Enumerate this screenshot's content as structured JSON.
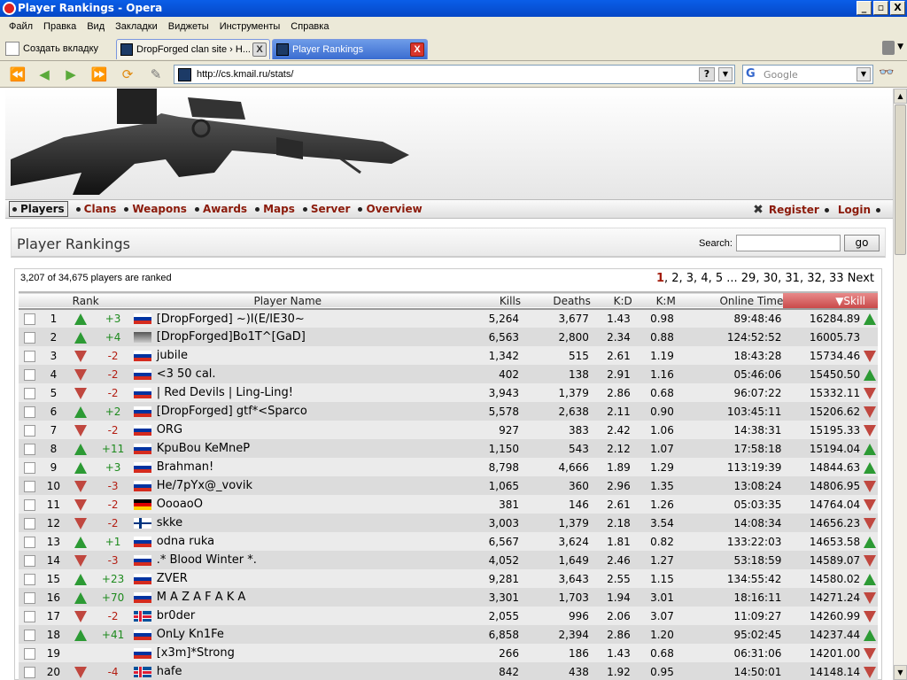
{
  "window": {
    "title": "Player Rankings - Opera",
    "minimize": "_",
    "maximize": "▫",
    "close": "X"
  },
  "menu": [
    "Файл",
    "Правка",
    "Вид",
    "Закладки",
    "Виджеты",
    "Инструменты",
    "Справка"
  ],
  "tabs": {
    "new_tab": "Создать вкладку",
    "tab1": "DropForged clan site › H...",
    "tab2": "Player Rankings",
    "close": "X"
  },
  "address": {
    "url": "http://cs.kmail.ru/stats/",
    "help": "?"
  },
  "searchbox": {
    "engine": "Google"
  },
  "nav": {
    "items": [
      "Players",
      "Clans",
      "Weapons",
      "Awards",
      "Maps",
      "Server",
      "Overview"
    ],
    "register": "Register",
    "login": "Login"
  },
  "panel": {
    "title": "Player Rankings",
    "search_label": "Search:",
    "go": "go"
  },
  "summary": "3,207 of 34,675 players are ranked",
  "pager": {
    "current": "1",
    "rest": ", 2, 3, 4, 5 ... 29, 30, 31, 32, 33",
    "next": "Next"
  },
  "columns": {
    "rank": "Rank",
    "name": "Player Name",
    "kills": "Kills",
    "deaths": "Deaths",
    "kd": "K:D",
    "km": "K:M",
    "time": "Online Time",
    "skill": "Skill"
  },
  "rows": [
    {
      "rank": "1",
      "dir": "up",
      "chg": "+3",
      "flag": "ru",
      "name": "[DropForged] ~)I(E/IE30~",
      "kills": "5,264",
      "deaths": "3,677",
      "kd": "1.43",
      "km": "0.98",
      "time": "89:48:46",
      "skill": "16284.89",
      "sdir": "up"
    },
    {
      "rank": "2",
      "dir": "up",
      "chg": "+4",
      "flag": "gr",
      "name": "[DropForged]Bo1T^[GaD]",
      "kills": "6,563",
      "deaths": "2,800",
      "kd": "2.34",
      "km": "0.88",
      "time": "124:52:52",
      "skill": "16005.73",
      "sdir": ""
    },
    {
      "rank": "3",
      "dir": "down",
      "chg": "-2",
      "flag": "ru",
      "name": "jubile",
      "kills": "1,342",
      "deaths": "515",
      "kd": "2.61",
      "km": "1.19",
      "time": "18:43:28",
      "skill": "15734.46",
      "sdir": "down"
    },
    {
      "rank": "4",
      "dir": "down",
      "chg": "-2",
      "flag": "ru",
      "name": "<3 50 cal.",
      "kills": "402",
      "deaths": "138",
      "kd": "2.91",
      "km": "1.16",
      "time": "05:46:06",
      "skill": "15450.50",
      "sdir": "up"
    },
    {
      "rank": "5",
      "dir": "down",
      "chg": "-2",
      "flag": "ru",
      "name": "| Red Devils | Ling-Ling!",
      "kills": "3,943",
      "deaths": "1,379",
      "kd": "2.86",
      "km": "0.68",
      "time": "96:07:22",
      "skill": "15332.11",
      "sdir": "down"
    },
    {
      "rank": "6",
      "dir": "up",
      "chg": "+2",
      "flag": "ru",
      "name": "[DropForged] gtf*<Sparco",
      "kills": "5,578",
      "deaths": "2,638",
      "kd": "2.11",
      "km": "0.90",
      "time": "103:45:11",
      "skill": "15206.62",
      "sdir": "down"
    },
    {
      "rank": "7",
      "dir": "down",
      "chg": "-2",
      "flag": "ru",
      "name": "ORG",
      "kills": "927",
      "deaths": "383",
      "kd": "2.42",
      "km": "1.06",
      "time": "14:38:31",
      "skill": "15195.33",
      "sdir": "down"
    },
    {
      "rank": "8",
      "dir": "up",
      "chg": "+11",
      "flag": "ru",
      "name": "KpuBou KeMneP",
      "kills": "1,150",
      "deaths": "543",
      "kd": "2.12",
      "km": "1.07",
      "time": "17:58:18",
      "skill": "15194.04",
      "sdir": "up"
    },
    {
      "rank": "9",
      "dir": "up",
      "chg": "+3",
      "flag": "ru",
      "name": "Brahman!",
      "kills": "8,798",
      "deaths": "4,666",
      "kd": "1.89",
      "km": "1.29",
      "time": "113:19:39",
      "skill": "14844.63",
      "sdir": "up"
    },
    {
      "rank": "10",
      "dir": "down",
      "chg": "-3",
      "flag": "ru",
      "name": "He/7pYx@_vovik",
      "kills": "1,065",
      "deaths": "360",
      "kd": "2.96",
      "km": "1.35",
      "time": "13:08:24",
      "skill": "14806.95",
      "sdir": "down"
    },
    {
      "rank": "11",
      "dir": "down",
      "chg": "-2",
      "flag": "de",
      "name": "OooaoO",
      "kills": "381",
      "deaths": "146",
      "kd": "2.61",
      "km": "1.26",
      "time": "05:03:35",
      "skill": "14764.04",
      "sdir": "down"
    },
    {
      "rank": "12",
      "dir": "down",
      "chg": "-2",
      "flag": "fi",
      "name": "skke",
      "kills": "3,003",
      "deaths": "1,379",
      "kd": "2.18",
      "km": "3.54",
      "time": "14:08:34",
      "skill": "14656.23",
      "sdir": "down"
    },
    {
      "rank": "13",
      "dir": "up",
      "chg": "+1",
      "flag": "ru",
      "name": "odna ruka",
      "kills": "6,567",
      "deaths": "3,624",
      "kd": "1.81",
      "km": "0.82",
      "time": "133:22:03",
      "skill": "14653.58",
      "sdir": "up"
    },
    {
      "rank": "14",
      "dir": "down",
      "chg": "-3",
      "flag": "ru",
      "name": ".* Blood Winter *.",
      "kills": "4,052",
      "deaths": "1,649",
      "kd": "2.46",
      "km": "1.27",
      "time": "53:18:59",
      "skill": "14589.07",
      "sdir": "down"
    },
    {
      "rank": "15",
      "dir": "up",
      "chg": "+23",
      "flag": "ru",
      "name": "ZVER",
      "kills": "9,281",
      "deaths": "3,643",
      "kd": "2.55",
      "km": "1.15",
      "time": "134:55:42",
      "skill": "14580.02",
      "sdir": "up"
    },
    {
      "rank": "16",
      "dir": "up",
      "chg": "+70",
      "flag": "ru",
      "name": "M A Z A F A K A",
      "kills": "3,301",
      "deaths": "1,703",
      "kd": "1.94",
      "km": "3.01",
      "time": "18:16:11",
      "skill": "14271.24",
      "sdir": "down"
    },
    {
      "rank": "17",
      "dir": "down",
      "chg": "-2",
      "flag": "is",
      "name": "br0der",
      "kills": "2,055",
      "deaths": "996",
      "kd": "2.06",
      "km": "3.07",
      "time": "11:09:27",
      "skill": "14260.99",
      "sdir": "down"
    },
    {
      "rank": "18",
      "dir": "up",
      "chg": "+41",
      "flag": "ru",
      "name": "OnLy Kn1Fe",
      "kills": "6,858",
      "deaths": "2,394",
      "kd": "2.86",
      "km": "1.20",
      "time": "95:02:45",
      "skill": "14237.44",
      "sdir": "up"
    },
    {
      "rank": "19",
      "dir": "",
      "chg": "",
      "flag": "ru",
      "name": "[x3m]*Strong",
      "kills": "266",
      "deaths": "186",
      "kd": "1.43",
      "km": "0.68",
      "time": "06:31:06",
      "skill": "14201.00",
      "sdir": "down"
    },
    {
      "rank": "20",
      "dir": "down",
      "chg": "-4",
      "flag": "is",
      "name": "hafe",
      "kills": "842",
      "deaths": "438",
      "kd": "1.92",
      "km": "0.95",
      "time": "14:50:01",
      "skill": "14148.14",
      "sdir": "down"
    }
  ]
}
